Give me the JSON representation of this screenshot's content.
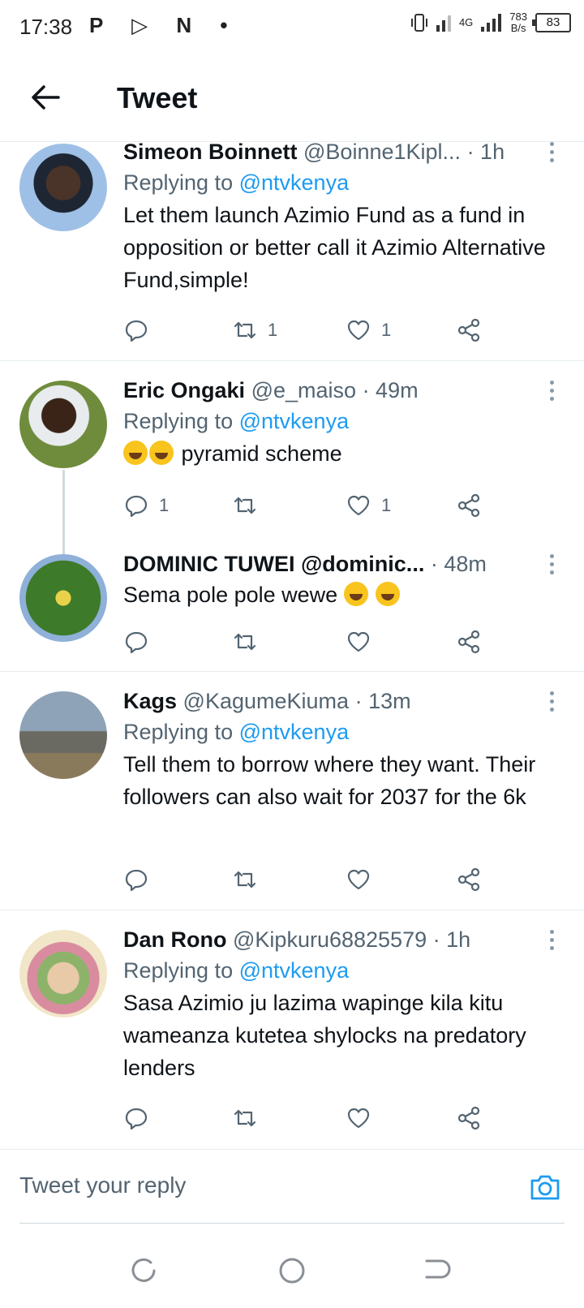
{
  "status_bar": {
    "time": "17:38",
    "left_icons": "P ▷ N •",
    "network_type": "4G",
    "speed_value": "783",
    "speed_unit": "B/s",
    "battery": "83"
  },
  "header": {
    "title": "Tweet"
  },
  "tweets": [
    {
      "name": "Simeon Boinnett",
      "handle": "@Boinne1Kipl...",
      "time": "· 1h",
      "replying_prefix": "Replying to",
      "replying_to": "@ntvkenya",
      "text": "Let them launch Azimio Fund as a fund in opposition or better call it Azimio Alternative Fund,simple!",
      "replies": "",
      "retweets": "1",
      "likes": "1"
    },
    {
      "name": "Eric Ongaki",
      "handle": "@e_maiso",
      "time": "· 49m",
      "replying_prefix": "Replying to",
      "replying_to": "@ntvkenya",
      "text": "pyramid scheme",
      "replies": "1",
      "retweets": "",
      "likes": "1"
    },
    {
      "name": "DOMINIC TUWEI @dominic...",
      "handle": "",
      "time": "· 48m",
      "text": "Sema pole pole wewe",
      "replies": "",
      "retweets": "",
      "likes": ""
    },
    {
      "name": "Kags",
      "handle": "@KagumeKiuma",
      "time": "· 13m",
      "replying_prefix": "Replying to",
      "replying_to": "@ntvkenya",
      "text": "Tell them to borrow where they want. Their followers can also wait for 2037 for the 6k",
      "replies": "",
      "retweets": "",
      "likes": ""
    },
    {
      "name": "Dan Rono",
      "handle": "@Kipkuru68825579",
      "time": "· 1h",
      "replying_prefix": "Replying to",
      "replying_to": "@ntvkenya",
      "text": "Sasa Azimio ju lazima wapinge kila kitu wameanza kutetea shylocks na predatory lenders",
      "replies": "",
      "retweets": "",
      "likes": ""
    }
  ],
  "reply_bar": {
    "placeholder": "Tweet your reply"
  },
  "colors": {
    "accent": "#1d9bf0",
    "secondary_text": "#536471",
    "divider": "#e6ecf0"
  },
  "icons": [
    "back-arrow-icon",
    "more-vertical-icon",
    "reply-icon",
    "retweet-icon",
    "like-icon",
    "share-icon",
    "camera-icon",
    "recents-icon",
    "home-icon",
    "back-nav-icon"
  ]
}
